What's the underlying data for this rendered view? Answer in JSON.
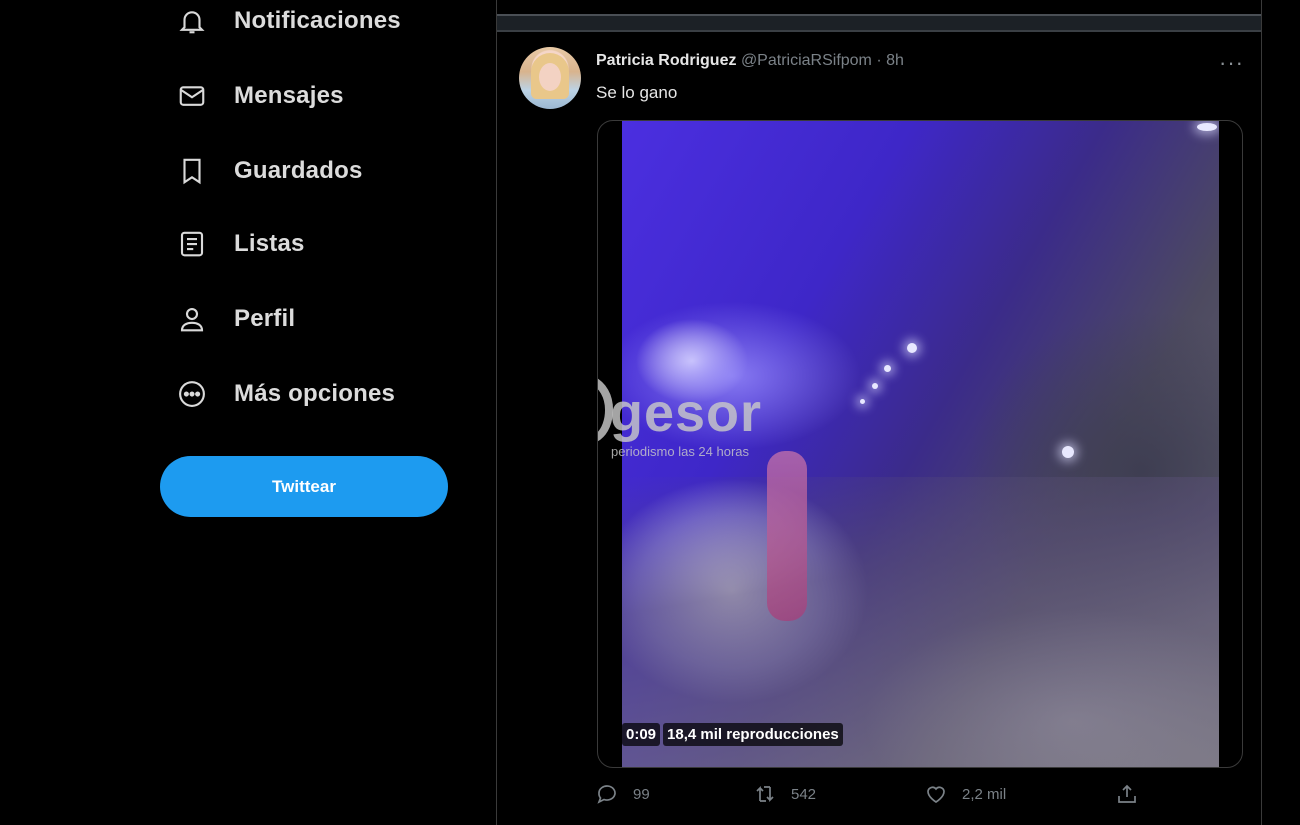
{
  "sidebar": {
    "items": [
      {
        "label": "Notificaciones",
        "icon": "bell-icon"
      },
      {
        "label": "Mensajes",
        "icon": "mail-icon"
      },
      {
        "label": "Guardados",
        "icon": "bookmark-icon"
      },
      {
        "label": "Listas",
        "icon": "list-icon"
      },
      {
        "label": "Perfil",
        "icon": "person-icon"
      },
      {
        "label": "Más opciones",
        "icon": "more-circle-icon"
      }
    ],
    "tweet_button": "Twittear"
  },
  "tweet": {
    "author_name": "Patricia Rodriguez",
    "handle": "@PatriciaRSifpom",
    "separator": "·",
    "time": "8h",
    "more": "···",
    "text": "Se lo gano",
    "media": {
      "duration": "0:09",
      "views": "18,4 mil reproducciones"
    },
    "actions": {
      "replies": "99",
      "retweets": "542",
      "likes": "2,2 mil"
    }
  },
  "watermark": {
    "symbol": "@",
    "brand": "gesor",
    "tagline": "periodismo las 24 horas"
  },
  "colors": {
    "background": "#000000",
    "accent": "#1d9bf0",
    "text": "#d9d9d9",
    "muted": "#7b8288"
  }
}
